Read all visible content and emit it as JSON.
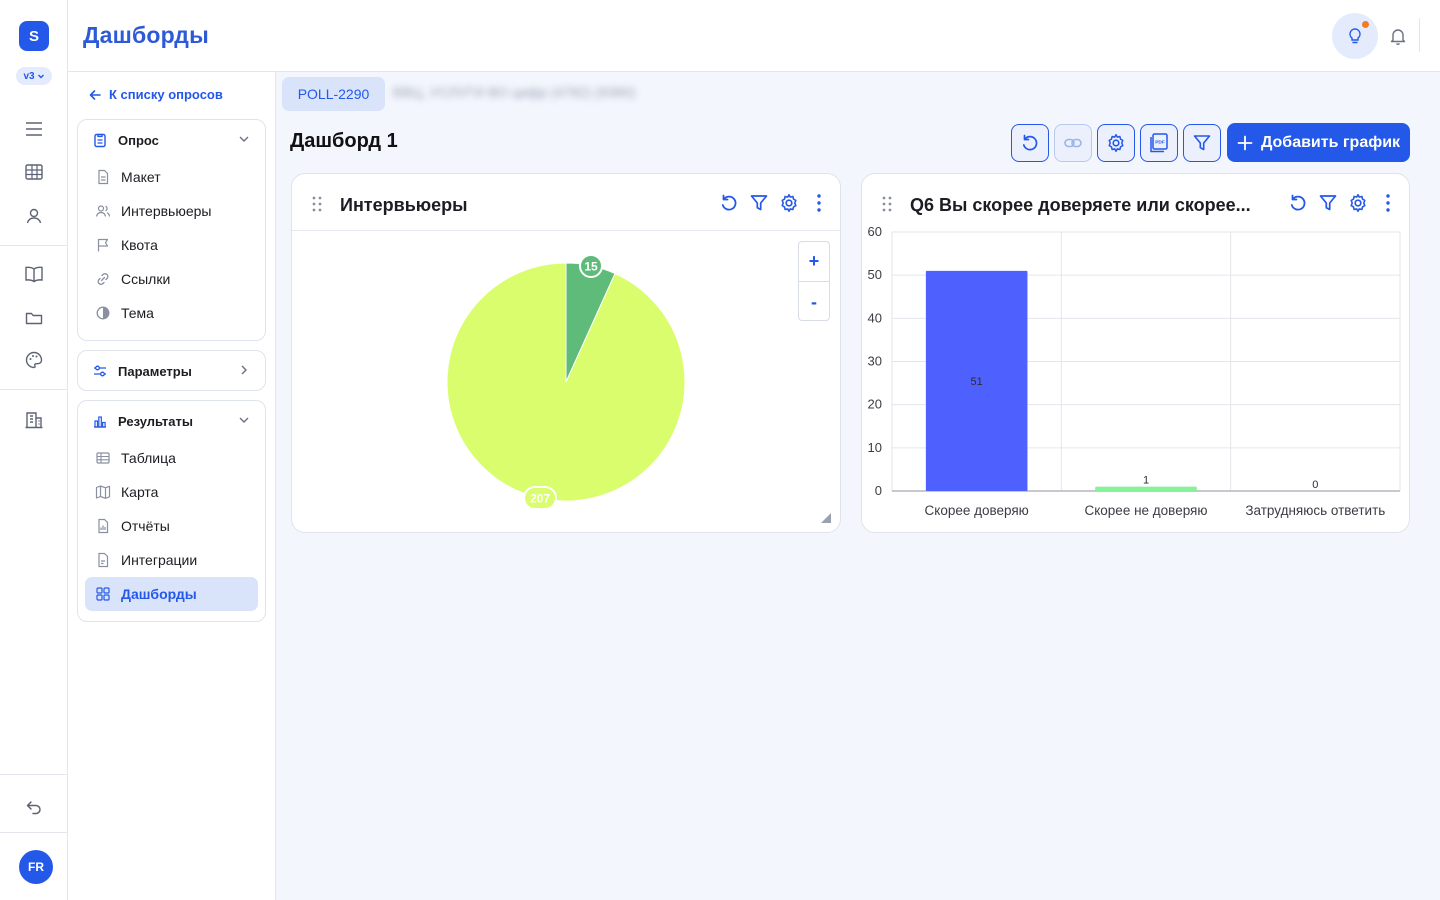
{
  "app": {
    "logo": "S",
    "version": "v3",
    "title": "Дашборды",
    "user_initials": "FR"
  },
  "rail": {
    "icons": [
      "menu-icon",
      "table-icon",
      "user-icon",
      "book-icon",
      "folder-icon",
      "palette-icon",
      "building-icon",
      "undo-icon"
    ]
  },
  "sidebar": {
    "back_label": "К списку опросов",
    "survey": {
      "title": "Опрос",
      "items": [
        {
          "label": "Макет",
          "icon": "document-icon"
        },
        {
          "label": "Интервьюеры",
          "icon": "users-icon"
        },
        {
          "label": "Квота",
          "icon": "flag-icon"
        },
        {
          "label": "Ссылки",
          "icon": "link-icon"
        },
        {
          "label": "Тема",
          "icon": "contrast-icon"
        }
      ]
    },
    "parameters": {
      "title": "Параметры"
    },
    "results": {
      "title": "Результаты",
      "items": [
        {
          "label": "Таблица",
          "icon": "table-icon"
        },
        {
          "label": "Карта",
          "icon": "map-icon"
        },
        {
          "label": "Отчёты",
          "icon": "report-icon"
        },
        {
          "label": "Интеграции",
          "icon": "integration-icon"
        },
        {
          "label": "Дашборды",
          "icon": "grid-icon",
          "active": true
        }
      ]
    }
  },
  "content": {
    "poll_id": "POLL-2290",
    "poll_name": "ВВЦ, УСЛУГИ ВО цифр (4782) (9380)",
    "dashboard_title": "Дашборд 1",
    "add_chart_label": "Добавить график",
    "toolbar_icons": [
      "refresh-icon",
      "link-icon",
      "settings-icon",
      "pdf-icon",
      "filter-icon"
    ]
  },
  "colors": {
    "accent": "#2458e8",
    "pie_large": "#dafd6e",
    "pie_small": "#5fbb79",
    "bar_main": "#4e61ff",
    "bar_minor": "#86f29a"
  },
  "chart_data": [
    {
      "type": "pie",
      "title": "Интервьюеры",
      "series": [
        {
          "value": 15,
          "color": "#5fbb79"
        },
        {
          "value": 207,
          "color": "#dafd6e"
        }
      ],
      "data_labels": [
        "15",
        "207"
      ],
      "zoom_in": "+",
      "zoom_out": "-"
    },
    {
      "type": "bar",
      "title": "Q6 Вы скорее доверяете или скорее...",
      "categories": [
        "Скорее доверяю",
        "Скорее не доверяю",
        "Затрудняюсь ответить"
      ],
      "values": [
        51,
        1,
        0
      ],
      "colors": [
        "#4e61ff",
        "#86f29a",
        "#dafd6e"
      ],
      "ylim": [
        0,
        60
      ],
      "yticks": [
        0,
        10,
        20,
        30,
        40,
        50,
        60
      ],
      "grid": true
    }
  ]
}
